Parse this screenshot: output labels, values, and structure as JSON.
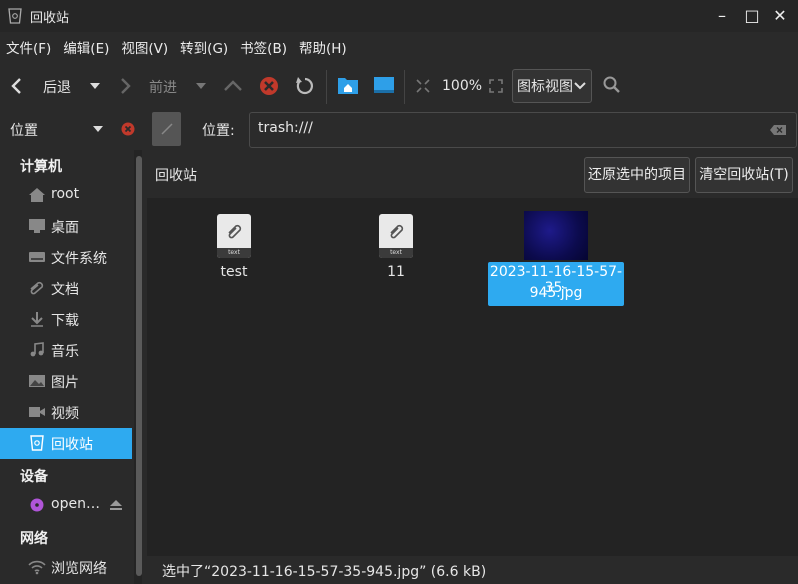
{
  "window": {
    "title": "回收站",
    "minimize": "–",
    "maximize": "□",
    "close": "✕"
  },
  "menubar": [
    "文件(F)",
    "编辑(E)",
    "视图(V)",
    "转到(G)",
    "书签(B)",
    "帮助(H)"
  ],
  "toolbar": {
    "back_label": "后退",
    "forward_label": "前进",
    "zoom": "100%",
    "view_mode": "图标视图"
  },
  "location": {
    "mode": "位置",
    "label": "位置:",
    "path": "trash:///"
  },
  "sidebar": {
    "sections": [
      {
        "title": "计算机",
        "items": [
          {
            "label": "root",
            "icon": "home-icon"
          },
          {
            "label": "桌面",
            "icon": "desktop-icon"
          },
          {
            "label": "文件系统",
            "icon": "drive-icon"
          },
          {
            "label": "文档",
            "icon": "paperclip-icon"
          },
          {
            "label": "下载",
            "icon": "download-icon"
          },
          {
            "label": "音乐",
            "icon": "music-icon"
          },
          {
            "label": "图片",
            "icon": "picture-icon"
          },
          {
            "label": "视频",
            "icon": "video-icon"
          },
          {
            "label": "回收站",
            "icon": "trash-icon",
            "active": true
          }
        ]
      },
      {
        "title": "设备",
        "items": [
          {
            "label": "open…",
            "icon": "disc-icon"
          }
        ]
      },
      {
        "title": "网络",
        "items": [
          {
            "label": "浏览网络",
            "icon": "wifi-icon"
          }
        ]
      }
    ]
  },
  "main": {
    "header": "回收站",
    "restore_button": "还原选中的项目",
    "empty_button": "清空回收站(T)",
    "files": [
      {
        "name": "test",
        "type": "text",
        "tag": "text"
      },
      {
        "name": "11",
        "type": "text",
        "tag": "text"
      },
      {
        "name": "2023-11-16-15-57-35-945.jpg",
        "name_line1": "2023-11-16-15-57-35-",
        "name_line2": "945.jpg",
        "type": "image",
        "selected": true
      }
    ]
  },
  "status": "选中了“2023-11-16-15-57-35-945.jpg” (6.6 kB)",
  "colors": {
    "accent": "#2eaaf0",
    "background": "#232323"
  }
}
